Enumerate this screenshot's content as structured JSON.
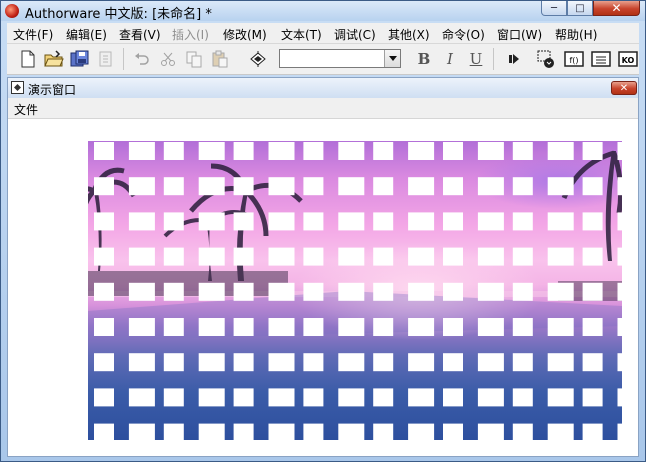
{
  "window": {
    "title": "Authorware 中文版: [未命名] *",
    "minimize_glyph": "─",
    "maximize_glyph": "□",
    "close_glyph": "✕"
  },
  "menu": [
    {
      "label": "文件(F)",
      "enabled": true
    },
    {
      "label": "编辑(E)",
      "enabled": true
    },
    {
      "label": "查看(V)",
      "enabled": true
    },
    {
      "label": "插入(I)",
      "enabled": false
    },
    {
      "label": "修改(M)",
      "enabled": true
    },
    {
      "label": "文本(T)",
      "enabled": true
    },
    {
      "label": "调试(C)",
      "enabled": true
    },
    {
      "label": "其他(X)",
      "enabled": true
    },
    {
      "label": "命令(O)",
      "enabled": true
    },
    {
      "label": "窗口(W)",
      "enabled": true
    },
    {
      "label": "帮助(H)",
      "enabled": true
    }
  ],
  "toolbar": {
    "buttons": [
      {
        "name": "new-file-icon"
      },
      {
        "name": "open-folder-icon"
      },
      {
        "name": "save-all-icon"
      },
      {
        "name": "import-icon"
      },
      {
        "name": "undo-icon"
      },
      {
        "name": "cut-icon"
      },
      {
        "name": "copy-icon"
      },
      {
        "name": "paste-icon"
      },
      {
        "name": "find-icon"
      },
      {
        "name": "restart-icon"
      },
      {
        "name": "control-panel-icon"
      },
      {
        "name": "functions-icon"
      },
      {
        "name": "variables-icon"
      },
      {
        "name": "knowledge-objects-icon"
      }
    ],
    "font_value": "",
    "bold_label": "B",
    "italic_label": "I",
    "underline_label": "U"
  },
  "presentation": {
    "title": "演示窗口",
    "menu_label": "文件",
    "close_glyph": "✕",
    "image": "tropical-sunset-pool-with-palms",
    "transition": "mosaic blocks"
  },
  "colors": {
    "title_bar": "#c9def5",
    "close_button": "#c8432c",
    "menu_bg": "#f0f0f0"
  }
}
